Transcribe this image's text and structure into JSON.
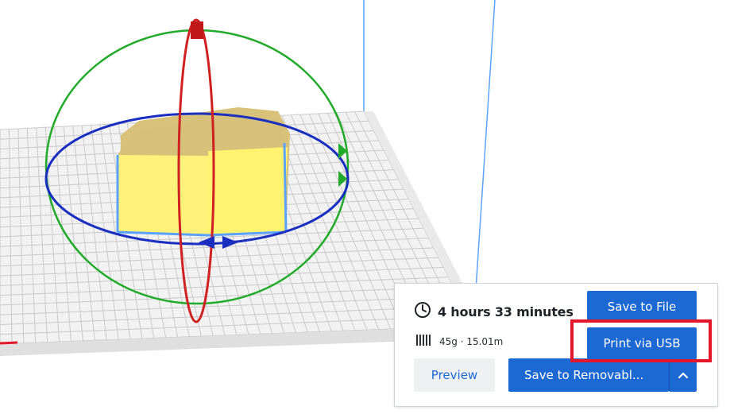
{
  "print_panel": {
    "print_time": "4 hours 33 minutes",
    "material_info": "45g · 15.01m",
    "save_to_file_label": "Save to File",
    "print_via_usb_label": "Print via USB",
    "preview_label": "Preview",
    "save_to_removable_label": "Save to Removabl...",
    "icons": {
      "clock": "clock-icon",
      "spool": "filament-spool-icon",
      "chevron": "chevron-up-icon"
    }
  },
  "colors": {
    "accent": "#1c69d4",
    "highlight": "#e3162b",
    "model": "#fff27a",
    "model_shade": "#d8c27a",
    "rotate_x": "#d02020",
    "rotate_y": "#22aa2a",
    "rotate_z": "#1a2ec0",
    "build_plate_grid": "#c9c9c9"
  }
}
